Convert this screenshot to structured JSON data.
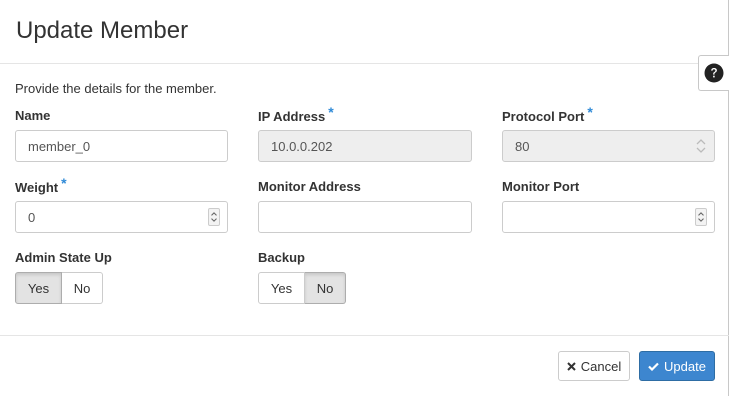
{
  "dialog": {
    "title": "Update Member",
    "intro": "Provide the details for the member."
  },
  "help": {
    "icon": "question-circle-icon"
  },
  "fields": {
    "name": {
      "label": "Name",
      "value": "member_0"
    },
    "ip_address": {
      "label": "IP Address",
      "value": "10.0.0.202",
      "required_marker": "*"
    },
    "protocol_port": {
      "label": "Protocol Port",
      "value": "80",
      "required_marker": "*"
    },
    "weight": {
      "label": "Weight",
      "value": "0",
      "required_marker": "*"
    },
    "monitor_address": {
      "label": "Monitor Address",
      "value": ""
    },
    "monitor_port": {
      "label": "Monitor Port",
      "value": ""
    },
    "admin_state_up": {
      "label": "Admin State Up",
      "yes": "Yes",
      "no": "No",
      "selected": "Yes"
    },
    "backup": {
      "label": "Backup",
      "yes": "Yes",
      "no": "No",
      "selected": "No"
    }
  },
  "footer": {
    "cancel_label": "Cancel",
    "update_label": "Update"
  },
  "colors": {
    "required": "#2f8ad7",
    "primary": "#3d86cf"
  }
}
